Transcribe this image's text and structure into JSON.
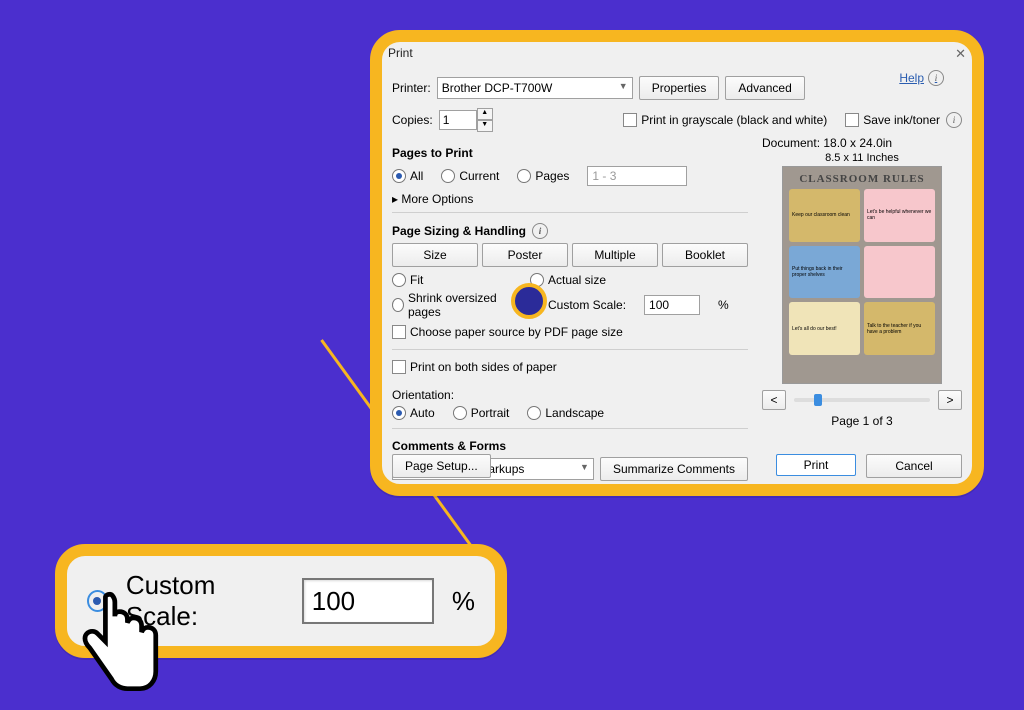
{
  "dialog": {
    "title": "Print",
    "help_label": "Help",
    "printer_label": "Printer:",
    "printer_value": "Brother DCP-T700W",
    "properties_btn": "Properties",
    "advanced_btn": "Advanced",
    "copies_label": "Copies:",
    "copies_value": "1",
    "grayscale_label": "Print in grayscale (black and white)",
    "saveink_label": "Save ink/toner",
    "pages_to_print_title": "Pages to Print",
    "radio_all": "All",
    "radio_current": "Current",
    "radio_pages": "Pages",
    "pages_range": "1 - 3",
    "more_options": "More Options",
    "sizing_title": "Page Sizing & Handling",
    "tab_size": "Size",
    "tab_poster": "Poster",
    "tab_multiple": "Multiple",
    "tab_booklet": "Booklet",
    "radio_fit": "Fit",
    "radio_actual": "Actual size",
    "radio_shrink": "Shrink oversized pages",
    "radio_custom": "Custom Scale:",
    "custom_value": "100",
    "custom_pct": "%",
    "choose_paper": "Choose paper source by PDF page size",
    "print_both": "Print on both sides of paper",
    "orientation_title": "Orientation:",
    "orient_auto": "Auto",
    "orient_portrait": "Portrait",
    "orient_landscape": "Landscape",
    "comments_title": "Comments & Forms",
    "comments_value": "Document and Markups",
    "summarize_btn": "Summarize Comments",
    "page_setup_btn": "Page Setup...",
    "print_btn": "Print",
    "cancel_btn": "Cancel"
  },
  "preview": {
    "doc_info": "Document: 18.0 x 24.0in",
    "paper_info": "8.5 x 11 Inches",
    "poster_title": "CLASSROOM RULES",
    "cards": {
      "c1": "Keep our classroom clean",
      "c2": "Let's be helpful whenever we can",
      "c3": "Put things back in their proper shelves",
      "c4": "",
      "c5": "Let's all do our best!",
      "c6": "Talk to the teacher if you have a problem"
    },
    "page_indicator": "Page 1 of 3"
  },
  "callout": {
    "label": "Custom Scale:",
    "value": "100",
    "pct": "%"
  }
}
